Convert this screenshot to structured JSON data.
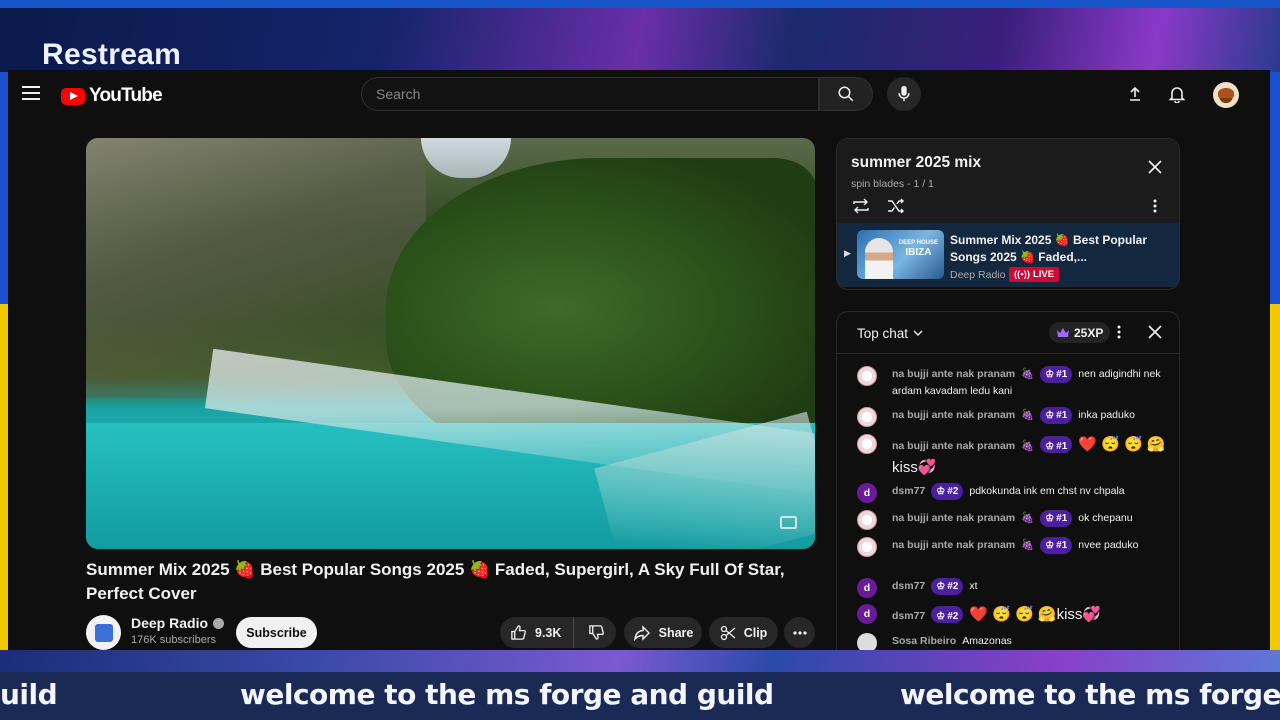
{
  "frame": {
    "brand": "Restream",
    "ticker_text": "welcome to the ms forge and guild",
    "ticker_left_fragment": "uild",
    "ticker_right_fragment": "welcome to the ms forge an"
  },
  "header": {
    "logo_text": "YouTube",
    "search_placeholder": "Search"
  },
  "video": {
    "title": "Summer Mix 2025 🍓 Best Popular Songs 2025 🍓 Faded, Supergirl, A Sky Full Of Star, Perfect Cover",
    "channel": "Deep Radio",
    "subscribers": "176K subscribers",
    "subscribe_label": "Subscribe",
    "likes": "9.3K",
    "share_label": "Share",
    "clip_label": "Clip"
  },
  "playlist": {
    "title": "summer 2025 mix",
    "subtitle": "spin blades - 1 / 1",
    "item": {
      "title": "Summer Mix 2025 🍓 Best Popular Songs 2025 🍓 Faded,...",
      "channel": "Deep Radio",
      "live_label": "LIVE",
      "thumb_text_1": "DEEP HOUSE",
      "thumb_text_2": "IBIZA"
    }
  },
  "chat": {
    "mode_label": "Top chat",
    "xp": "25XP",
    "messages": [
      {
        "author": "na bujji ante nak pranam",
        "emote": "🍇",
        "rank": "#1",
        "text": "nen adigindhi nek ardam kavadam ledu kani"
      },
      {
        "author": "na bujji ante nak pranam",
        "emote": "🍇",
        "rank": "#1",
        "text": "inka paduko"
      },
      {
        "author": "na bujji ante nak pranam",
        "emote": "🍇",
        "rank": "#1",
        "text": "❤️ 😴 😴 🤗kiss💞"
      },
      {
        "author": "dsm77",
        "rank": "#2",
        "text": "pdkokunda ink em chst nv chpala"
      },
      {
        "author": "na bujji ante nak pranam",
        "emote": "🍇",
        "rank": "#1",
        "text": "ok chepanu"
      },
      {
        "author": "na bujji ante nak pranam",
        "emote": "🍇",
        "rank": "#1",
        "text": "nvee paduko"
      },
      {
        "author": "dsm77",
        "rank": "#2",
        "text": "xt"
      },
      {
        "author": "dsm77",
        "rank": "#2",
        "text": "❤️ 😴 😴 🤗kiss💞"
      },
      {
        "author": "Sosa Ribeiro",
        "text": "Amazonas"
      }
    ]
  }
}
